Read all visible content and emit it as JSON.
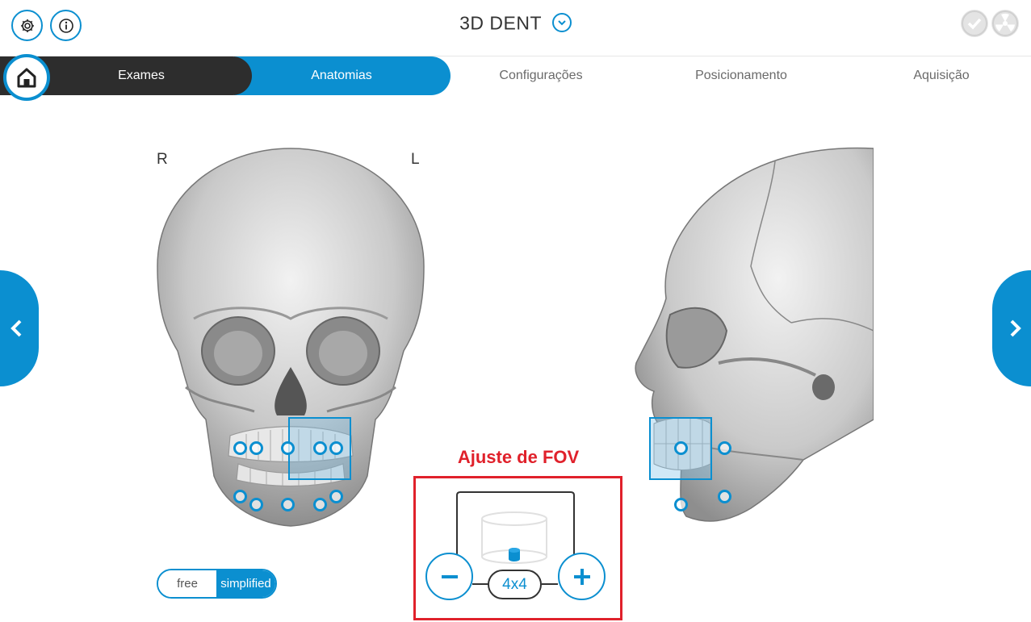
{
  "header": {
    "title": "3D DENT",
    "settings_icon": "gear-icon",
    "info_icon": "info-icon",
    "status_icons": [
      "check-icon",
      "radiation-icon"
    ]
  },
  "steps": [
    {
      "label": "Exames",
      "state": "done"
    },
    {
      "label": "Anatomias",
      "state": "active"
    },
    {
      "label": "Configurações",
      "state": "pending"
    },
    {
      "label": "Posicionamento",
      "state": "pending"
    },
    {
      "label": "Aquisição",
      "state": "pending"
    }
  ],
  "views": {
    "right_label": "R",
    "left_label": "L"
  },
  "mode_toggle": {
    "options": [
      "free",
      "simplified"
    ],
    "selected": "simplified"
  },
  "fov": {
    "caption": "Ajuste de FOV",
    "size": "4x4"
  },
  "colors": {
    "accent": "#0b8fd0",
    "dark": "#2d2d2d",
    "annotation": "#e0212b"
  }
}
